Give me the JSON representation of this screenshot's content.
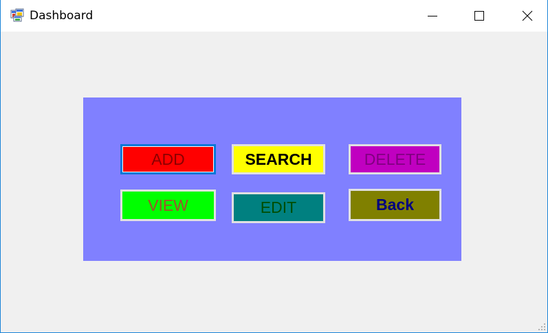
{
  "window": {
    "title": "Dashboard",
    "border_color": "#1883d7",
    "icon": "app-window-icon",
    "controls": [
      "minimize-icon",
      "maximize-icon",
      "close-icon"
    ]
  },
  "panel": {
    "background": "#8080ff",
    "buttons": {
      "add": {
        "label": "ADD",
        "background": "#ff0000",
        "focused": true
      },
      "search": {
        "label": "SEARCH",
        "background": "#ffff00"
      },
      "delete": {
        "label": "DELETE",
        "background": "#c000c0"
      },
      "view": {
        "label": "VIEW",
        "background": "#00ff00"
      },
      "edit": {
        "label": "EDIT",
        "background": "#008080"
      },
      "back": {
        "label": "Back",
        "background": "#808000"
      }
    }
  }
}
